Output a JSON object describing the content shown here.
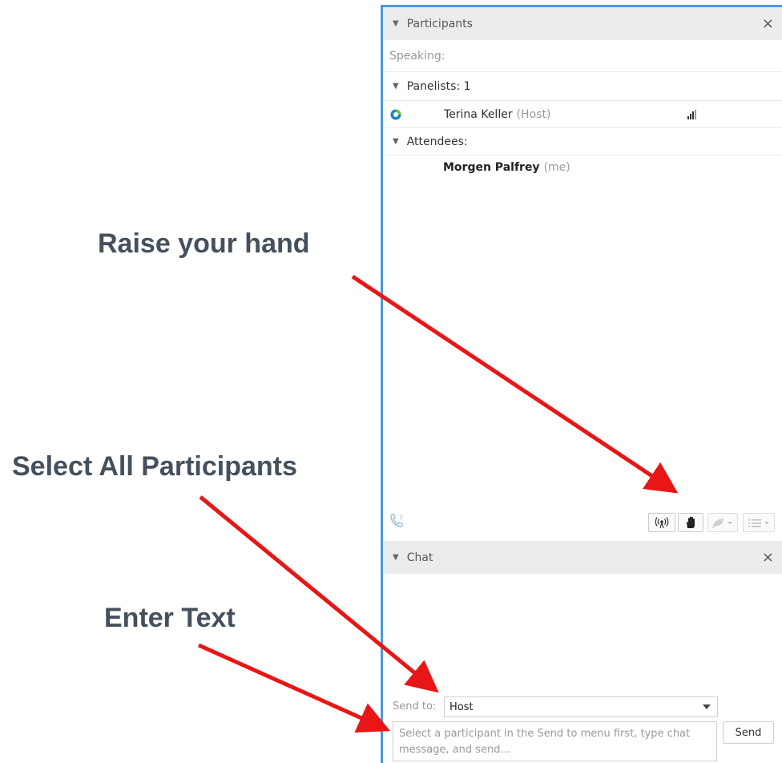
{
  "annotations": {
    "raise_hand": "Raise your hand",
    "select_all": "Select All Participants",
    "enter_text": "Enter Text"
  },
  "participants": {
    "title": "Participants",
    "close": "×",
    "speaking_label": "Speaking:",
    "panelists_label": "Panelists: 1",
    "attendees_label": "Attendees:",
    "panelist": {
      "name": "Terina Keller",
      "role": "(Host)"
    },
    "attendee": {
      "name": "Morgen Palfrey",
      "role": "(me)"
    }
  },
  "chat": {
    "title": "Chat",
    "close": "×",
    "send_to_label": "Send to:",
    "send_to_value": "Host",
    "input_placeholder": "Select a participant in the Send to menu first, type chat message, and send...",
    "send_button": "Send"
  },
  "colors": {
    "panel_border": "#4a9ad8",
    "arrow": "#e81616",
    "annotation_text": "#44505c"
  }
}
